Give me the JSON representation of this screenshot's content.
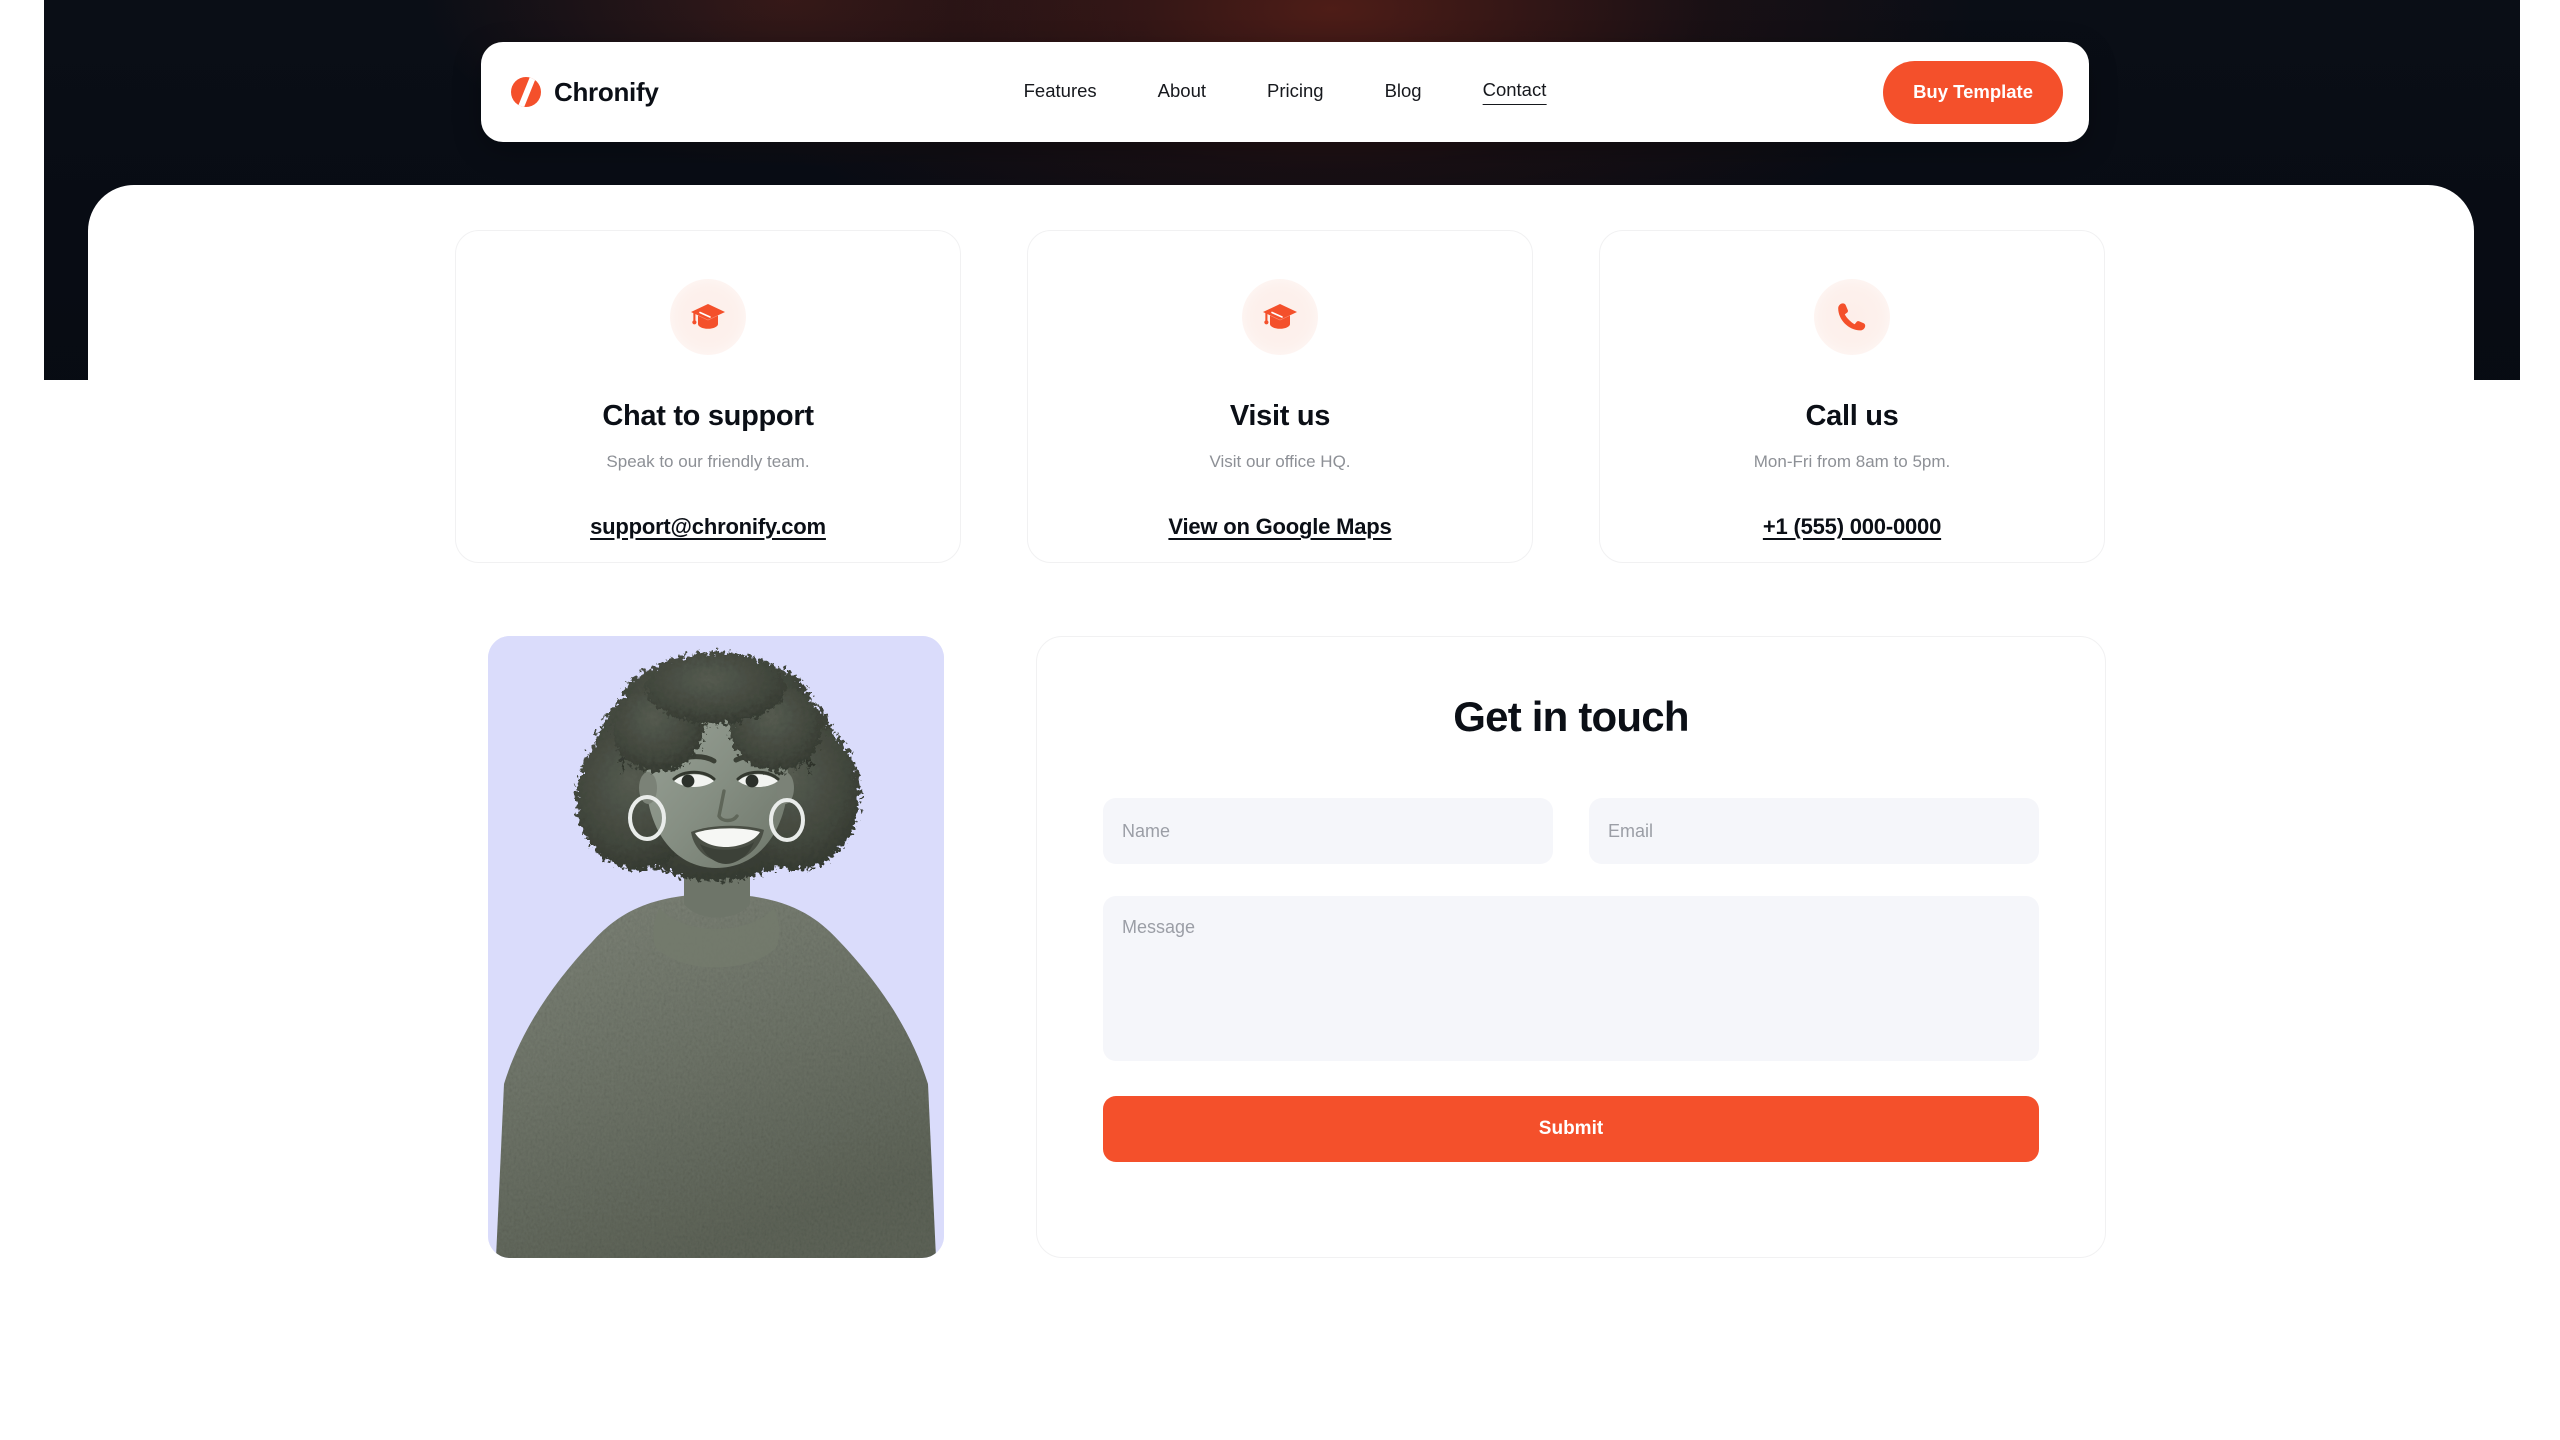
{
  "brand": {
    "name": "Chronify",
    "logo_icon": "chronify-circle-slash-icon",
    "accent_color": "#f4502b"
  },
  "nav": {
    "links": [
      {
        "label": "Features",
        "active": false
      },
      {
        "label": "About",
        "active": false
      },
      {
        "label": "Pricing",
        "active": false
      },
      {
        "label": "Blog",
        "active": false
      },
      {
        "label": "Contact",
        "active": true
      }
    ],
    "cta_label": "Buy Template"
  },
  "cards": [
    {
      "icon": "graduation-cap-icon",
      "title": "Chat to support",
      "subtitle": "Speak to our friendly team.",
      "link": "support@chronify.com"
    },
    {
      "icon": "graduation-cap-icon",
      "title": "Visit us",
      "subtitle": "Visit our office HQ.",
      "link": "View on Google Maps"
    },
    {
      "icon": "phone-icon",
      "title": "Call us",
      "subtitle": "Mon-Fri from 8am to 5pm.",
      "link": "+1 (555) 000-0000"
    }
  ],
  "photo": {
    "alt": "smiling-woman-portrait",
    "background_color": "#dadcfb"
  },
  "form": {
    "title": "Get in touch",
    "name_placeholder": "Name",
    "name_value": "",
    "email_placeholder": "Email",
    "email_value": "",
    "message_placeholder": "Message",
    "message_value": "",
    "submit_label": "Submit"
  }
}
